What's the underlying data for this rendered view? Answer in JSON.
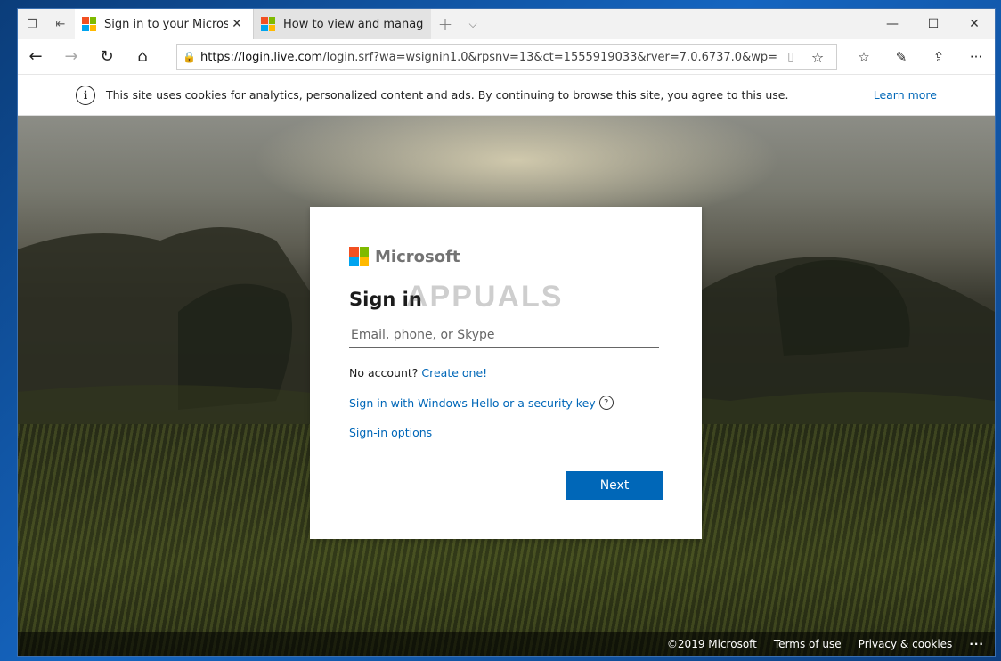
{
  "tabs": [
    {
      "title": "Sign in to your Microso",
      "close": "✕"
    },
    {
      "title": "How to view and manage co"
    }
  ],
  "tabbar": {
    "new_tab": "+",
    "tab_list": "⌵"
  },
  "window_controls": {
    "minimize": "—",
    "maximize": "☐",
    "close": "✕"
  },
  "navbar": {
    "url_domain": "https://login.live.com",
    "url_path": "/login.srf?wa=wsignin1.0&rpsnv=13&ct=1555919033&rver=7.0.6737.0&wp=MBI_SSL&wr"
  },
  "cookie_banner": {
    "message": "This site uses cookies for analytics, personalized content and ads. By continuing to browse this site, you agree to this use.",
    "learn_more": "Learn more"
  },
  "signin": {
    "brand": "Microsoft",
    "title": "Sign in",
    "email_placeholder": "Email, phone, or Skype",
    "no_account": "No account?",
    "create_link": "Create one!",
    "hello_link": "Sign in with Windows Hello or a security key",
    "options_link": "Sign-in options",
    "next_button": "Next"
  },
  "watermark": "APPUALS",
  "footer": {
    "copyright": "©2019 Microsoft",
    "terms": "Terms of use",
    "privacy": "Privacy & cookies",
    "more": "···"
  },
  "colors": {
    "accent": "#0067b8",
    "ms_red": "#f25022",
    "ms_green": "#7fba00",
    "ms_blue": "#00a4ef",
    "ms_yellow": "#ffb900"
  }
}
